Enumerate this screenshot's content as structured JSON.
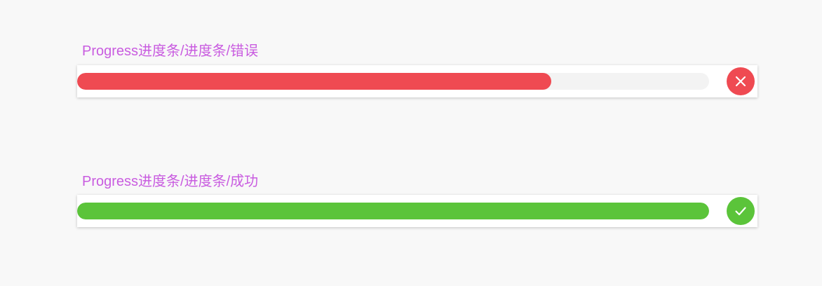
{
  "progress_error": {
    "label": "Progress进度条/进度条/错误",
    "value_percent": 75,
    "fill_color": "#ef4a52",
    "status_icon": "close-icon",
    "status_color": "#ef4a52"
  },
  "progress_success": {
    "label": "Progress进度条/进度条/成功",
    "value_percent": 100,
    "fill_color": "#5bc43a",
    "status_icon": "check-icon",
    "status_color": "#5bc43a"
  },
  "colors": {
    "label_text": "#c95ce0",
    "track": "#f3f3f3",
    "background": "#f8f8f8"
  }
}
